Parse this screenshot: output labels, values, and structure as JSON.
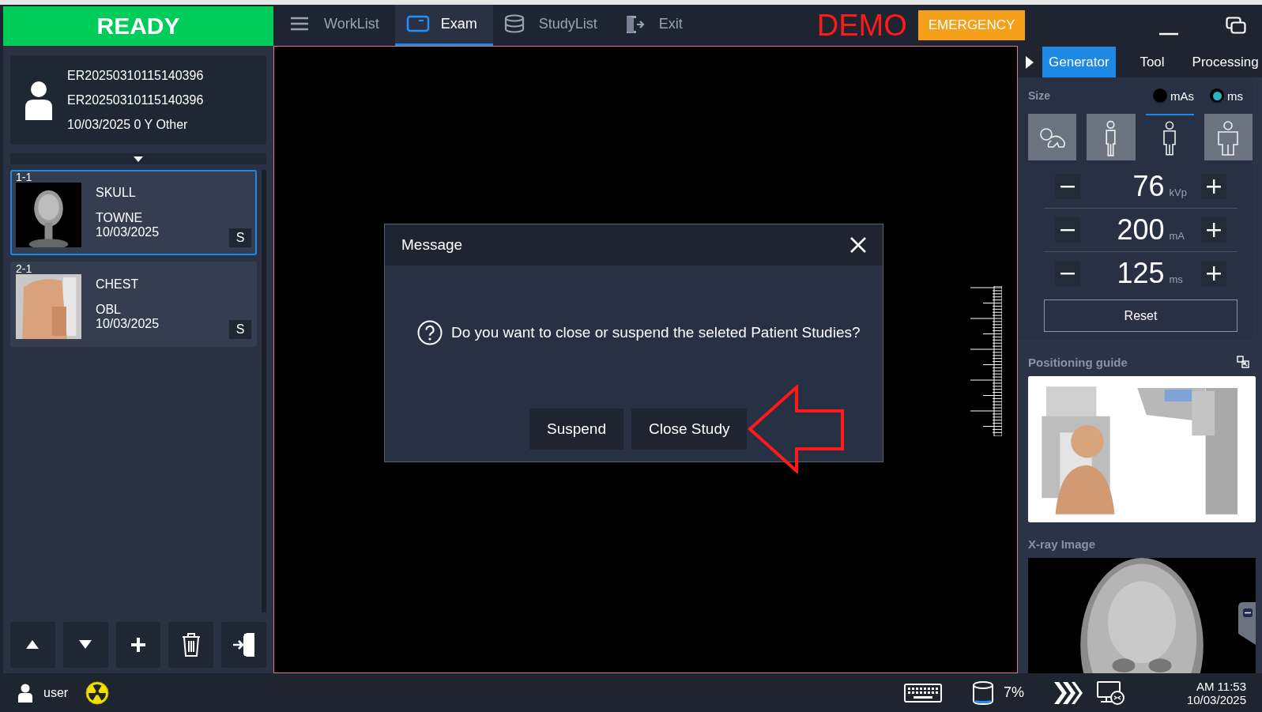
{
  "status": {
    "label": "READY"
  },
  "nav_tabs": [
    {
      "label": "WorkList",
      "selected": false
    },
    {
      "label": "Exam",
      "selected": true
    },
    {
      "label": "StudyList",
      "selected": false
    },
    {
      "label": "Exit",
      "selected": false
    }
  ],
  "demo_label": "DEMO",
  "emergency_button": "EMERGENCY",
  "patient": {
    "lines": [
      "ER20250310115140396",
      "ER20250310115140396",
      "10/03/2025 0 Y Other"
    ]
  },
  "studies": [
    {
      "number": "1-1",
      "body_part": "SKULL",
      "view": "TOWNE",
      "date": "10/03/2025",
      "badge": "S",
      "selected": true
    },
    {
      "number": "2-1",
      "body_part": "CHEST",
      "view": "OBL",
      "date": "10/03/2025",
      "badge": "S",
      "selected": false
    }
  ],
  "dialog": {
    "title": "Message",
    "message": "Do you want to close or suspend the seleted Patient Studies?",
    "buttons": [
      "Suspend",
      "Close Study"
    ]
  },
  "right_tabs": [
    {
      "label": "Generator",
      "selected": true
    },
    {
      "label": "Tool",
      "selected": false
    },
    {
      "label": "Processing",
      "selected": false
    }
  ],
  "generator": {
    "size_label": "Size",
    "modes": [
      {
        "label": "mAs",
        "selected": false
      },
      {
        "label": "ms",
        "selected": true
      }
    ],
    "sizes": [
      {
        "kind": "infant",
        "selected": false
      },
      {
        "kind": "slim",
        "selected": false
      },
      {
        "kind": "medium",
        "selected": true
      },
      {
        "kind": "large",
        "selected": false
      }
    ],
    "params": [
      {
        "value": "76",
        "unit": "kVp"
      },
      {
        "value": "200",
        "unit": "mA"
      },
      {
        "value": "125",
        "unit": "ms"
      }
    ],
    "reset_button": "Reset"
  },
  "positioning_guide": {
    "title": "Positioning guide"
  },
  "xray_image": {
    "title": "X-ray Image"
  },
  "status_bar": {
    "user": "user",
    "storage": "7%",
    "time": "AM 11:53",
    "date": "10/03/2025"
  }
}
